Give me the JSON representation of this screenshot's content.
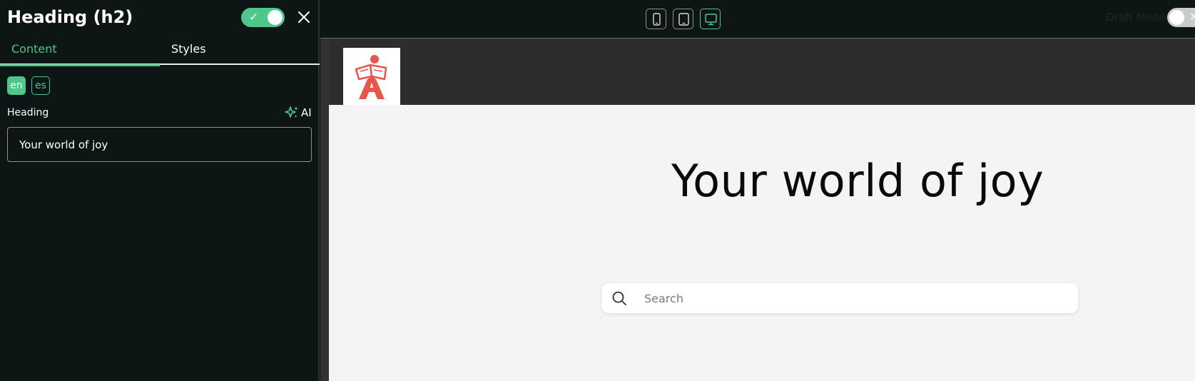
{
  "panel": {
    "title": "Heading (h2)",
    "toggle_check": "✓",
    "tabs": [
      {
        "label": "Content",
        "active": true
      },
      {
        "label": "Styles",
        "active": false
      }
    ],
    "languages": [
      {
        "code": "en",
        "active": true
      },
      {
        "code": "es",
        "active": false
      }
    ],
    "field_label": "Heading",
    "ai_label": "AI",
    "heading_value": "Your world of joy"
  },
  "device_bar": {
    "devices": [
      "mobile-icon",
      "tablet-icon",
      "desktop-icon"
    ],
    "active": "desktop"
  },
  "draft": {
    "label": "Draft Mode",
    "toggle_x": "×"
  },
  "preview": {
    "hero_heading": "Your world of joy",
    "search_placeholder": "Search"
  },
  "colors": {
    "accent": "#4fc68a",
    "panel_bg": "#0d1614",
    "logo_red": "#e8554a"
  }
}
